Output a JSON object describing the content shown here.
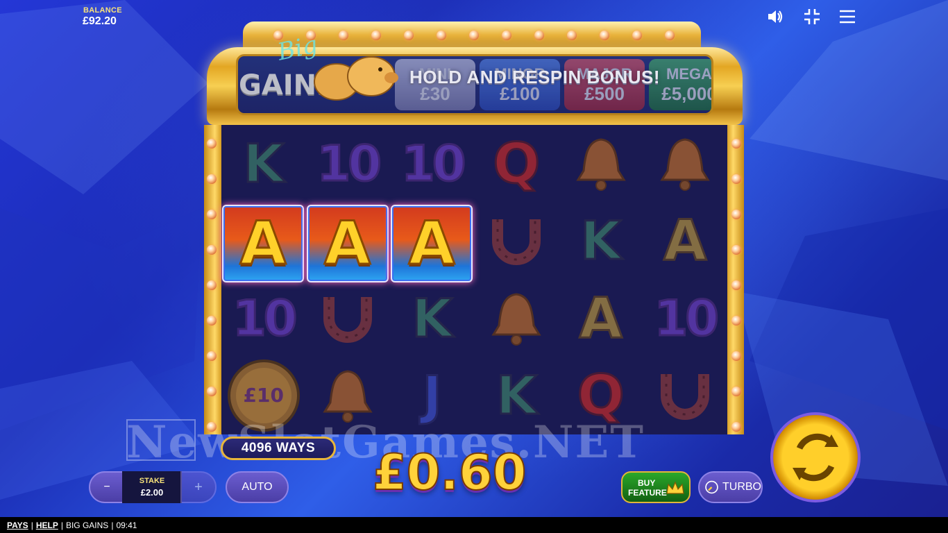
{
  "header": {
    "balance_label": "BALANCE",
    "balance_value": "£92.20",
    "icons": [
      "sound-icon",
      "fullscreen-exit-icon",
      "menu-icon"
    ]
  },
  "marquee": {
    "logo_script": "Big",
    "logo_text": "GAINS",
    "bonus_text": "HOLD AND RESPIN BONUS!",
    "jackpots": [
      {
        "name": "MINI",
        "value": "£30",
        "color": "#b9b9d6"
      },
      {
        "name": "MINOR",
        "value": "£100",
        "color": "#3f6fe0"
      },
      {
        "name": "MAJOR",
        "value": "£500",
        "color": "#d8424a"
      },
      {
        "name": "MEGA",
        "value": "£5,000",
        "color": "#2fa24a"
      }
    ]
  },
  "reels": {
    "grid": [
      [
        "K",
        "10",
        "10",
        "Q",
        "bell",
        "bell"
      ],
      [
        "A",
        "A",
        "A",
        "horseshoe",
        "K",
        "A"
      ],
      [
        "10",
        "horseshoe",
        "K",
        "bell",
        "A",
        "10"
      ],
      [
        "coin",
        "bell",
        "J",
        "K",
        "Q",
        "horseshoe"
      ]
    ],
    "coin_value": "£10",
    "winning_cells": [
      [
        1,
        0
      ],
      [
        1,
        1
      ],
      [
        1,
        2
      ]
    ]
  },
  "bottom": {
    "ways": "4096 WAYS",
    "win_amount": "£0.60",
    "stake_label": "STAKE",
    "stake_value": "£2.00",
    "minus": "−",
    "plus": "+",
    "auto": "AUTO",
    "buy_line1": "BUY",
    "buy_line2": "FEATURE",
    "turbo": "TURBO"
  },
  "watermark": "NewSlotGames.NET",
  "footer": {
    "pays": "PAYS",
    "help": "HELP",
    "game": "BIG GAINS",
    "time": "09:41"
  }
}
